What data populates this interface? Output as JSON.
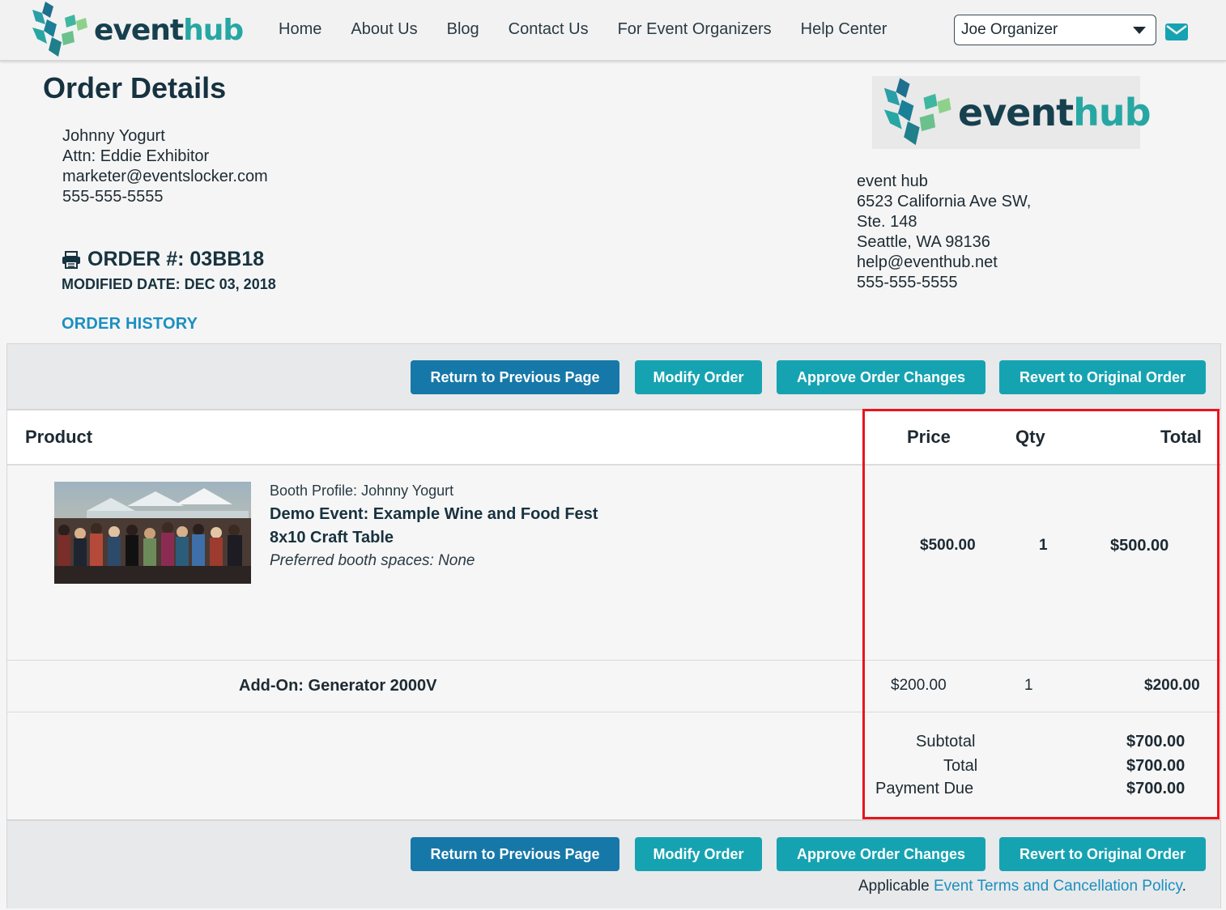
{
  "nav": {
    "brand_part1": "event",
    "brand_part2": "hub",
    "links": [
      "Home",
      "About Us",
      "Blog",
      "Contact Us",
      "For Event Organizers",
      "Help Center"
    ],
    "user_select": "Joe Organizer",
    "mail_icon": "envelope-icon"
  },
  "colors": {
    "brand_dark": "#17404f",
    "brand_teal": "#27a7a3",
    "button_dark": "#1678a8",
    "button_teal": "#16a3b1",
    "link": "#1b8fc1",
    "highlight": "#e8141c"
  },
  "page": {
    "title": "Order Details",
    "customer": {
      "name": "Johnny Yogurt",
      "attn": "Attn: Eddie Exhibitor",
      "email": "marketer@eventslocker.com",
      "phone": "555-555-5555"
    },
    "order_number_label": "ORDER #: 03BB18",
    "modified_date_label": "MODIFIED DATE: DEC 03, 2018",
    "order_history_link": "ORDER HISTORY",
    "print_icon": "print-icon"
  },
  "company": {
    "name": "event hub",
    "address1": "6523 California Ave SW,",
    "address2": "Ste. 148",
    "city": "Seattle, WA 98136",
    "email": "help@eventhub.net",
    "phone": "555-555-5555"
  },
  "buttons": {
    "return": "Return to Previous Page",
    "modify": "Modify Order",
    "approve": "Approve Order Changes",
    "revert": "Revert to Original Order"
  },
  "table": {
    "headers": {
      "product": "Product",
      "price": "Price",
      "qty": "Qty",
      "total": "Total"
    },
    "main_item": {
      "booth_profile": "Booth Profile: Johnny Yogurt",
      "event_name": "Demo Event: Example Wine and Food Fest",
      "product_name": "8x10 Craft Table",
      "preferences": "Preferred booth spaces: None",
      "price": "$500.00",
      "qty": "1",
      "total": "$500.00"
    },
    "addon": {
      "name": "Add-On: Generator 2000V",
      "price": "$200.00",
      "qty": "1",
      "total": "$200.00"
    },
    "totals": {
      "subtotal_label": "Subtotal",
      "subtotal": "$700.00",
      "total_label": "Total",
      "total": "$700.00",
      "payment_due_label": "Payment Due",
      "payment_due": "$700.00"
    }
  },
  "terms": {
    "prefix": "Applicable ",
    "link": "Event Terms and Cancellation Policy",
    "suffix": "."
  }
}
